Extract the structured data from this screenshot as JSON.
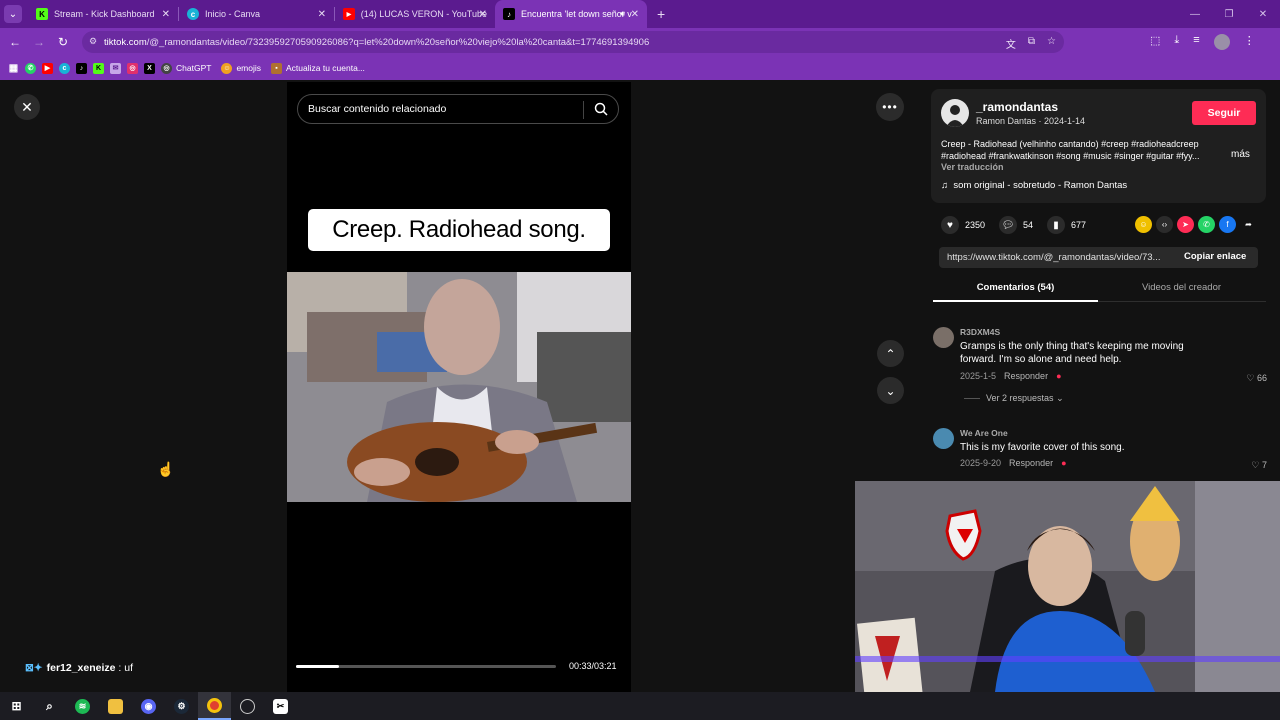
{
  "browser": {
    "tabs": [
      {
        "title": "Stream - Kick Dashboard",
        "icon": "kick-icon"
      },
      {
        "title": "Inicio - Canva",
        "icon": "canva-icon"
      },
      {
        "title": "(14) LUCAS VERON - YouTube",
        "icon": "youtube-icon"
      },
      {
        "title": "Encuentra 'let down señor v",
        "icon": "tiktok-icon"
      }
    ],
    "url_host": "tiktok.com",
    "url_path": "/@_ramondantas/video/7323959270590926086?q=let%20down%20señor%20viejo%20la%20canta&t=1774691394906",
    "bookmarks": [
      "ChatGPT",
      "emojis",
      "Actualiza tu cuenta..."
    ]
  },
  "player": {
    "search_placeholder": "Buscar contenido relacionado",
    "caption": "Creep. Radiohead song.",
    "time": "00:33/03:21",
    "progress_fraction": 0.164
  },
  "post": {
    "username": "_ramondantas",
    "subtitle": "Ramon Dantas · 2024-1-14",
    "follow_label": "Seguir",
    "description": "Creep - Radiohead (velhinho cantando) #creep #radioheadcreep #radiohead #frankwatkinson #song #music #singer #guitar #fyy...",
    "more_label": "más",
    "translate_label": "Ver traducción",
    "sound": "som original - sobretudo - Ramon Dantas",
    "likes": "2350",
    "comments": "54",
    "saves": "677",
    "link": "https://www.tiktok.com/@_ramondantas/video/73...",
    "copy_label": "Copiar enlace",
    "tab_comments": "Comentarios (54)",
    "tab_videos": "Videos del creador"
  },
  "comments": [
    {
      "user": "R3DXM4S",
      "text": "Gramps is the only thing that's keeping me moving forward. I'm so alone and need help.",
      "date": "2025-1-5",
      "reply": "Responder",
      "likes": "66",
      "replies": "Ver 2 respuestas"
    },
    {
      "user": "We Are One",
      "text": "This is my favorite cover of this song.",
      "date": "2025-9-20",
      "reply": "Responder",
      "likes": "7"
    }
  ],
  "overlay": {
    "chat_user": "fer12_xeneize",
    "chat_msg": " : uf"
  },
  "colors": {
    "chrome": "#7b33b5",
    "tabstrip": "#5b1b8f",
    "follow": "#fe2c55"
  }
}
